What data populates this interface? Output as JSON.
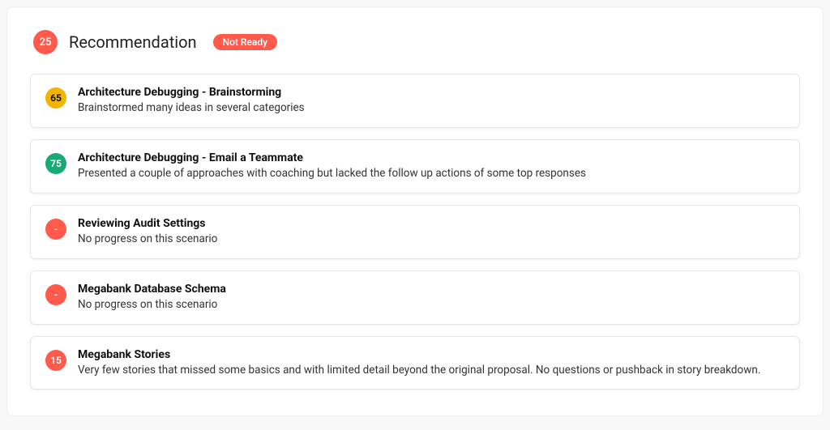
{
  "header": {
    "score": "25",
    "title": "Recommendation",
    "status": "Not Ready"
  },
  "items": [
    {
      "score": "65",
      "score_color": "amber",
      "title": "Architecture Debugging - Brainstorming",
      "desc": "Brainstormed many ideas in several categories"
    },
    {
      "score": "75",
      "score_color": "green",
      "title": "Architecture Debugging - Email a Teammate",
      "desc": "Presented a couple of approaches with coaching but lacked the follow up actions of some top responses"
    },
    {
      "score": "-",
      "score_color": "red",
      "title": "Reviewing Audit Settings",
      "desc": "No progress on this scenario"
    },
    {
      "score": "-",
      "score_color": "red",
      "title": "Megabank Database Schema",
      "desc": "No progress on this scenario"
    },
    {
      "score": "15",
      "score_color": "red",
      "title": "Megabank Stories",
      "desc": "Very few stories that missed some basics and with limited detail beyond the original proposal. No questions or pushback in story breakdown."
    }
  ]
}
